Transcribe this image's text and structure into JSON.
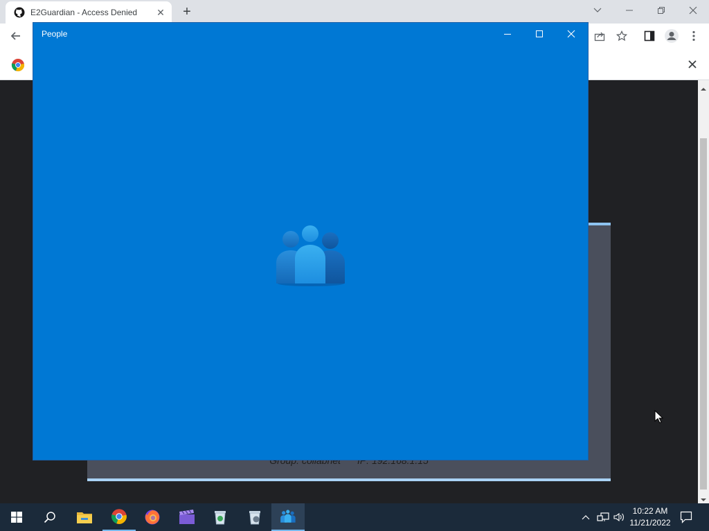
{
  "browser": {
    "tab_title": "E2Guardian - Access Denied",
    "new_tab_symbol": "+"
  },
  "blocked_page": {
    "group_label": "Group:",
    "group_value": "collabnet",
    "ip_label": "IP:",
    "ip_value": "192.168.1.15"
  },
  "people_window": {
    "title": "People"
  },
  "taskbar": {
    "time": "10:22 AM",
    "date": "11/21/2022"
  },
  "colors": {
    "people_bg": "#0078d4",
    "taskbar_bg": "#1b2a3a",
    "accent": "#76b9ed"
  }
}
